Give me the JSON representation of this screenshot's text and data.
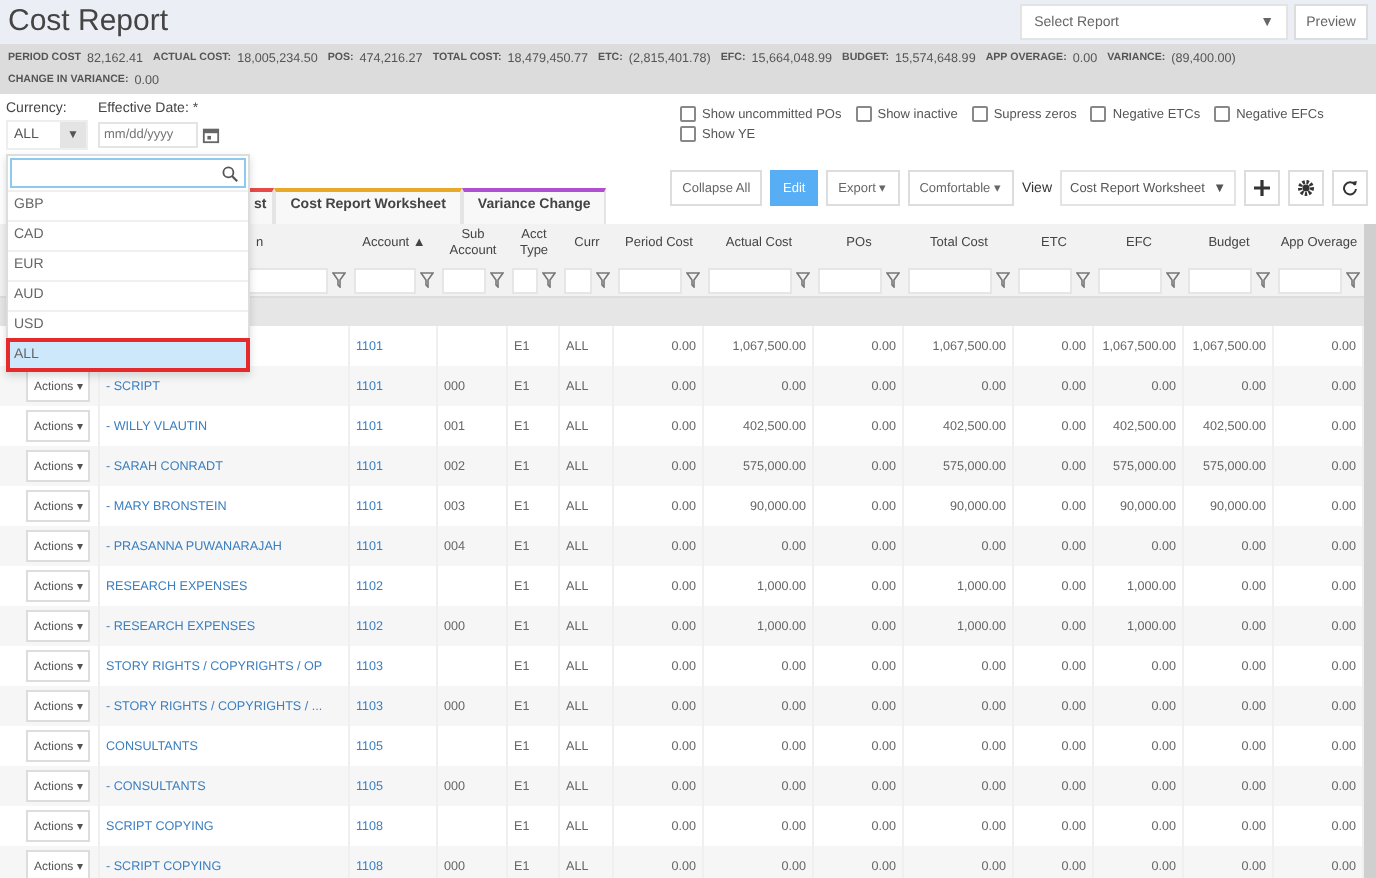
{
  "header": {
    "title": "Cost Report",
    "report_select": {
      "placeholder": "Select Report",
      "caret": "▼"
    },
    "preview_button": "Preview"
  },
  "summary": [
    {
      "label": "PERIOD COST",
      "value": "82,162.41"
    },
    {
      "label": "ACTUAL COST:",
      "value": "18,005,234.50"
    },
    {
      "label": "POS:",
      "value": "474,216.27"
    },
    {
      "label": "TOTAL COST:",
      "value": "18,479,450.77"
    },
    {
      "label": "ETC:",
      "value": "(2,815,401.78)"
    },
    {
      "label": "EFC:",
      "value": "15,664,048.99"
    },
    {
      "label": "BUDGET:",
      "value": "15,574,648.99"
    },
    {
      "label": "APP OVERAGE:",
      "value": "0.00"
    },
    {
      "label": "VARIANCE:",
      "value": "(89,400.00)"
    },
    {
      "label": "CHANGE IN VARIANCE:",
      "value": "0.00"
    }
  ],
  "filters": {
    "currency_label": "Currency:",
    "currency_value": "ALL",
    "currency_caret": "▼",
    "date_label": "Effective Date: *",
    "date_placeholder": "mm/dd/yyyy",
    "checkboxes": [
      {
        "label": "Show uncommitted POs",
        "checked": false
      },
      {
        "label": "Show inactive",
        "checked": false
      },
      {
        "label": "Supress zeros",
        "checked": false
      },
      {
        "label": "Negative ETCs",
        "checked": false
      },
      {
        "label": "Negative EFCs",
        "checked": false
      },
      {
        "label": "Show YE",
        "checked": false
      }
    ]
  },
  "currency_dropdown": {
    "options": [
      {
        "label": "GBP",
        "selected": false
      },
      {
        "label": "CAD",
        "selected": false
      },
      {
        "label": "EUR",
        "selected": false
      },
      {
        "label": "AUD",
        "selected": false
      },
      {
        "label": "USD",
        "selected": false
      },
      {
        "label": "ALL",
        "selected": true
      }
    ]
  },
  "tabs": [
    {
      "label": "st",
      "color": "#e84a4a"
    },
    {
      "label": "Cost Report Worksheet",
      "color": "#e8a92a"
    },
    {
      "label": "Variance Change",
      "color": "#b04fd0"
    }
  ],
  "toolbar": {
    "collapse_all": "Collapse All",
    "edit": "Edit",
    "export": "Export ▾",
    "density": "Comfortable ▾",
    "view_label": "View",
    "view_value": "Cost Report Worksheet",
    "view_caret": "▼"
  },
  "table": {
    "columns": [
      {
        "label": "n"
      },
      {
        "label": "Account ▲"
      },
      {
        "label": "Sub Account"
      },
      {
        "label": "Acct Type"
      },
      {
        "label": "Curr"
      },
      {
        "label": "Period Cost"
      },
      {
        "label": "Actual Cost"
      },
      {
        "label": "POs"
      },
      {
        "label": "Total Cost"
      },
      {
        "label": "ETC"
      },
      {
        "label": "EFC"
      },
      {
        "label": "Budget"
      },
      {
        "label": "App Overage"
      }
    ],
    "rows": [
      {
        "account": "1101",
        "sub_account": "",
        "acct_type": "E1",
        "curr": "ALL",
        "values": [
          "0.00",
          "1,067,500.00",
          "0.00",
          "1,067,500.00",
          "0.00",
          "1,067,500.00",
          "1,067,500.00",
          "0.00"
        ]
      },
      {
        "actions": "Actions ▾",
        "description": "- SCRIPT",
        "account": "1101",
        "sub_account": "000",
        "acct_type": "E1",
        "curr": "ALL",
        "values": [
          "0.00",
          "0.00",
          "0.00",
          "0.00",
          "0.00",
          "0.00",
          "0.00",
          "0.00"
        ]
      },
      {
        "actions": "Actions ▾",
        "description": "- WILLY VLAUTIN",
        "account": "1101",
        "sub_account": "001",
        "acct_type": "E1",
        "curr": "ALL",
        "values": [
          "0.00",
          "402,500.00",
          "0.00",
          "402,500.00",
          "0.00",
          "402,500.00",
          "402,500.00",
          "0.00"
        ]
      },
      {
        "actions": "Actions ▾",
        "description": "- SARAH CONRADT",
        "account": "1101",
        "sub_account": "002",
        "acct_type": "E1",
        "curr": "ALL",
        "values": [
          "0.00",
          "575,000.00",
          "0.00",
          "575,000.00",
          "0.00",
          "575,000.00",
          "575,000.00",
          "0.00"
        ]
      },
      {
        "actions": "Actions ▾",
        "description": "- MARY BRONSTEIN",
        "account": "1101",
        "sub_account": "003",
        "acct_type": "E1",
        "curr": "ALL",
        "values": [
          "0.00",
          "90,000.00",
          "0.00",
          "90,000.00",
          "0.00",
          "90,000.00",
          "90,000.00",
          "0.00"
        ]
      },
      {
        "actions": "Actions ▾",
        "description": "- PRASANNA PUWANARAJAH",
        "account": "1101",
        "sub_account": "004",
        "acct_type": "E1",
        "curr": "ALL",
        "values": [
          "0.00",
          "0.00",
          "0.00",
          "0.00",
          "0.00",
          "0.00",
          "0.00",
          "0.00"
        ]
      },
      {
        "actions": "Actions ▾",
        "description": "RESEARCH EXPENSES",
        "account": "1102",
        "sub_account": "",
        "acct_type": "E1",
        "curr": "ALL",
        "values": [
          "0.00",
          "1,000.00",
          "0.00",
          "1,000.00",
          "0.00",
          "1,000.00",
          "0.00",
          "0.00"
        ]
      },
      {
        "actions": "Actions ▾",
        "description": "- RESEARCH EXPENSES",
        "account": "1102",
        "sub_account": "000",
        "acct_type": "E1",
        "curr": "ALL",
        "values": [
          "0.00",
          "1,000.00",
          "0.00",
          "1,000.00",
          "0.00",
          "1,000.00",
          "0.00",
          "0.00"
        ]
      },
      {
        "actions": "Actions ▾",
        "description": "STORY RIGHTS / COPYRIGHTS / OP",
        "account": "1103",
        "sub_account": "",
        "acct_type": "E1",
        "curr": "ALL",
        "values": [
          "0.00",
          "0.00",
          "0.00",
          "0.00",
          "0.00",
          "0.00",
          "0.00",
          "0.00"
        ]
      },
      {
        "actions": "Actions ▾",
        "description": "- STORY RIGHTS / COPYRIGHTS / ...",
        "account": "1103",
        "sub_account": "000",
        "acct_type": "E1",
        "curr": "ALL",
        "values": [
          "0.00",
          "0.00",
          "0.00",
          "0.00",
          "0.00",
          "0.00",
          "0.00",
          "0.00"
        ]
      },
      {
        "actions": "Actions ▾",
        "description": "CONSULTANTS",
        "account": "1105",
        "sub_account": "",
        "acct_type": "E1",
        "curr": "ALL",
        "values": [
          "0.00",
          "0.00",
          "0.00",
          "0.00",
          "0.00",
          "0.00",
          "0.00",
          "0.00"
        ]
      },
      {
        "actions": "Actions ▾",
        "description": "- CONSULTANTS",
        "account": "1105",
        "sub_account": "000",
        "acct_type": "E1",
        "curr": "ALL",
        "values": [
          "0.00",
          "0.00",
          "0.00",
          "0.00",
          "0.00",
          "0.00",
          "0.00",
          "0.00"
        ]
      },
      {
        "actions": "Actions ▾",
        "description": "SCRIPT COPYING",
        "account": "1108",
        "sub_account": "",
        "acct_type": "E1",
        "curr": "ALL",
        "values": [
          "0.00",
          "0.00",
          "0.00",
          "0.00",
          "0.00",
          "0.00",
          "0.00",
          "0.00"
        ]
      },
      {
        "actions": "Actions ▾",
        "description": "- SCRIPT COPYING",
        "account": "1108",
        "sub_account": "000",
        "acct_type": "E1",
        "curr": "ALL",
        "values": [
          "0.00",
          "0.00",
          "0.00",
          "0.00",
          "0.00",
          "0.00",
          "0.00",
          "0.00"
        ]
      }
    ]
  }
}
